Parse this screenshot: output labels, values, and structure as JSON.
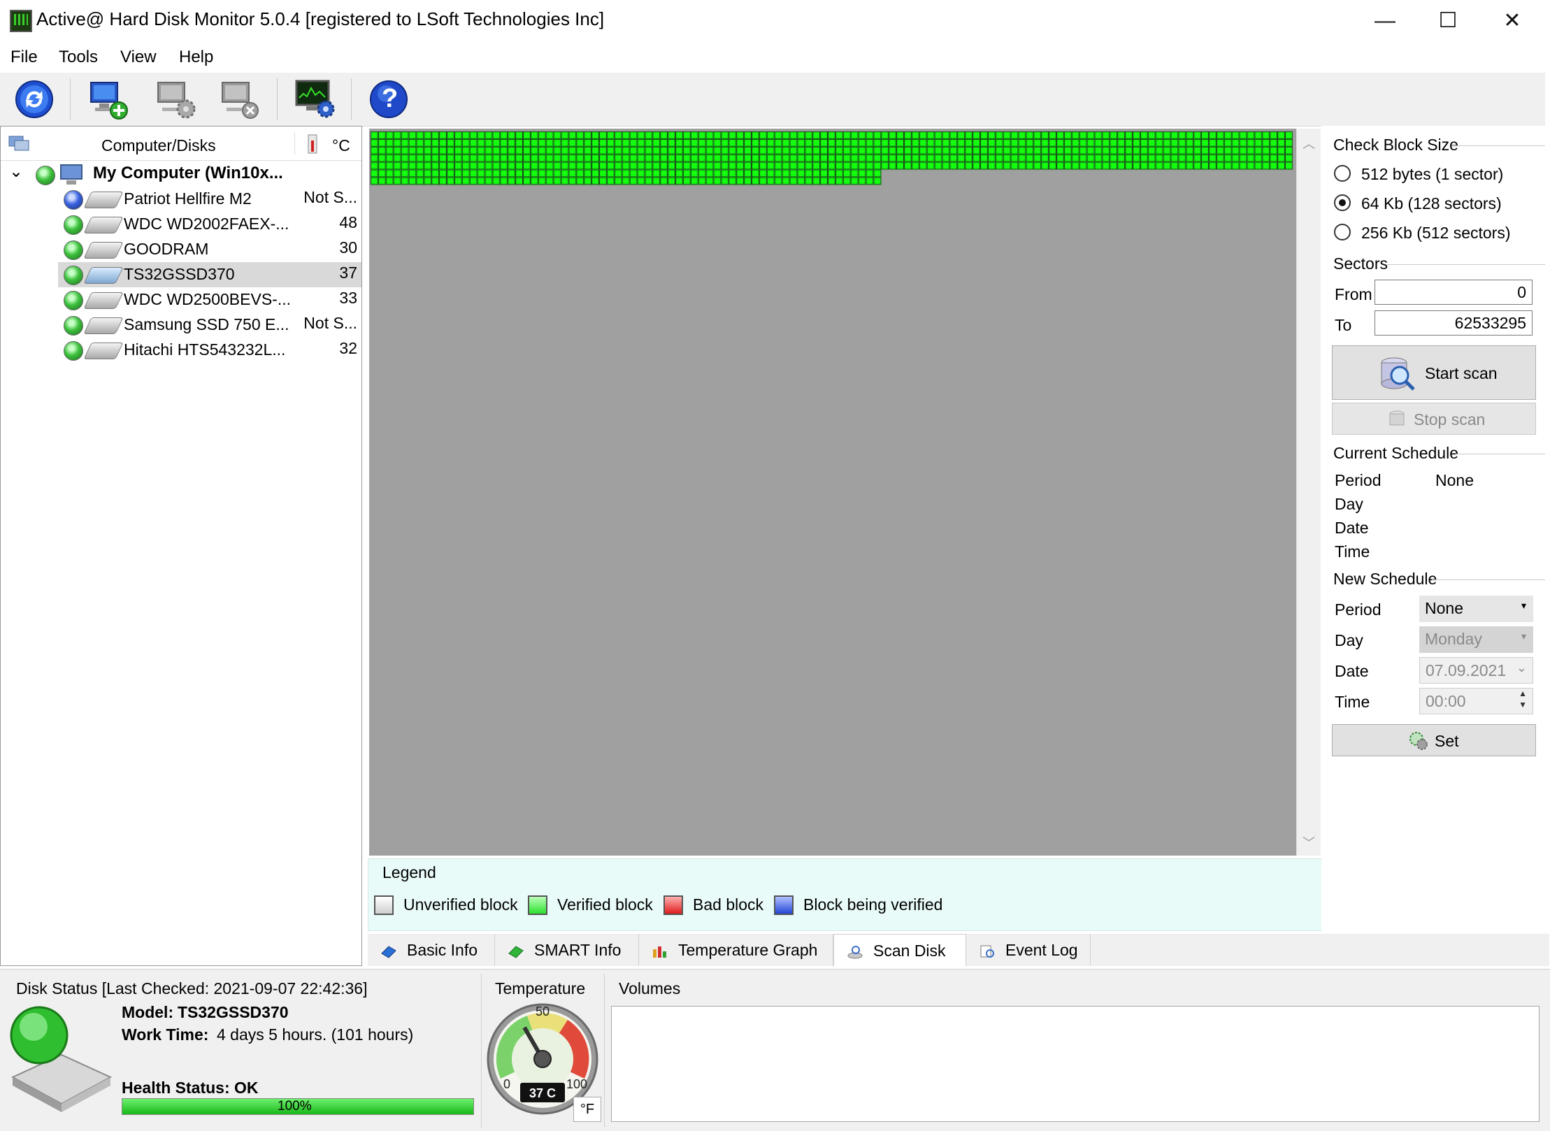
{
  "window": {
    "title": "Active@ Hard Disk Monitor 5.0.4 [registered to LSoft Technologies Inc]",
    "minimize": "—",
    "maximize": "☐",
    "close": "✕"
  },
  "menu": [
    "File",
    "Tools",
    "View",
    "Help"
  ],
  "toolbar": {
    "icons": [
      "refresh-icon",
      "add-computer-icon",
      "computer-settings-icon",
      "remove-computer-icon",
      "monitor-settings-icon",
      "help-icon"
    ],
    "help_glyph": "?"
  },
  "tree": {
    "header_label": "Computer/Disks",
    "temp_unit": "°C",
    "root": {
      "label": "My Computer (Win10x...",
      "expander": "⌄"
    },
    "disks": [
      {
        "name": "Patriot Hellfire M2",
        "temp": "Not S...",
        "status": "blue"
      },
      {
        "name": "WDC WD2002FAEX-...",
        "temp": "48",
        "status": "green"
      },
      {
        "name": "GOODRAM",
        "temp": "30",
        "status": "green"
      },
      {
        "name": "TS32GSSD370",
        "temp": "37",
        "status": "green",
        "selected": true
      },
      {
        "name": "WDC WD2500BEVS-...",
        "temp": "33",
        "status": "green"
      },
      {
        "name": "Samsung SSD 750 E...",
        "temp": "Not S...",
        "status": "green"
      },
      {
        "name": "Hitachi HTS543232L...",
        "temp": "32",
        "status": "green"
      }
    ]
  },
  "scan_map": {
    "verified_fraction": 0.1,
    "colors": {
      "verified": "#13ff0f",
      "unverified": "#a0a0a0",
      "grid": "#1a3a1a"
    }
  },
  "legend": {
    "title": "Legend",
    "items": [
      {
        "label": "Unverified block",
        "color": "#e6e6e6"
      },
      {
        "label": "Verified block",
        "color": "#2ee12e"
      },
      {
        "label": "Bad block",
        "color": "#e01c1c"
      },
      {
        "label": "Block being verified",
        "color": "#2446d6"
      }
    ]
  },
  "tabs": [
    {
      "label": "Basic Info",
      "icon": "basic-info-icon"
    },
    {
      "label": "SMART Info",
      "icon": "smart-info-icon"
    },
    {
      "label": "Temperature Graph",
      "icon": "temperature-graph-icon"
    },
    {
      "label": "Scan Disk",
      "icon": "scan-disk-icon",
      "active": true
    },
    {
      "label": "Event Log",
      "icon": "event-log-icon"
    }
  ],
  "right": {
    "block_size_title": "Check Block Size",
    "block_sizes": [
      {
        "label": "512 bytes (1 sector)",
        "checked": false
      },
      {
        "label": "64 Kb (128 sectors)",
        "checked": true
      },
      {
        "label": "256 Kb (512 sectors)",
        "checked": false
      }
    ],
    "sectors_title": "Sectors",
    "from_label": "From",
    "from_value": "0",
    "to_label": "To",
    "to_value": "62533295",
    "start_scan": "Start scan",
    "stop_scan": "Stop scan",
    "current_schedule_title": "Current Schedule",
    "current": {
      "period_label": "Period",
      "period_value": "None",
      "day_label": "Day",
      "date_label": "Date",
      "time_label": "Time"
    },
    "new_schedule_title": "New Schedule",
    "new": {
      "period_label": "Period",
      "period_value": "None",
      "day_label": "Day",
      "day_value": "Monday",
      "date_label": "Date",
      "date_value": "07.09.2021",
      "time_label": "Time",
      "time_value": "00:00"
    },
    "set_button": "Set"
  },
  "bottom": {
    "disk_status_title": "Disk Status [Last Checked: 2021-09-07 22:42:36]",
    "model_label": "Model:",
    "model_value": "TS32GSSD370",
    "work_time_label": "Work Time:",
    "work_time_value": "4 days 5 hours. (101 hours)",
    "health_label": "Health Status: OK",
    "health_percent_text": "100%",
    "health_fraction": 1.0,
    "temperature_title": "Temperature",
    "gauge_ticks": [
      "0",
      "50",
      "100"
    ],
    "gauge_value": 37,
    "gauge_readout": "37 C",
    "fahrenheit_button": "°F",
    "volumes_title": "Volumes"
  }
}
